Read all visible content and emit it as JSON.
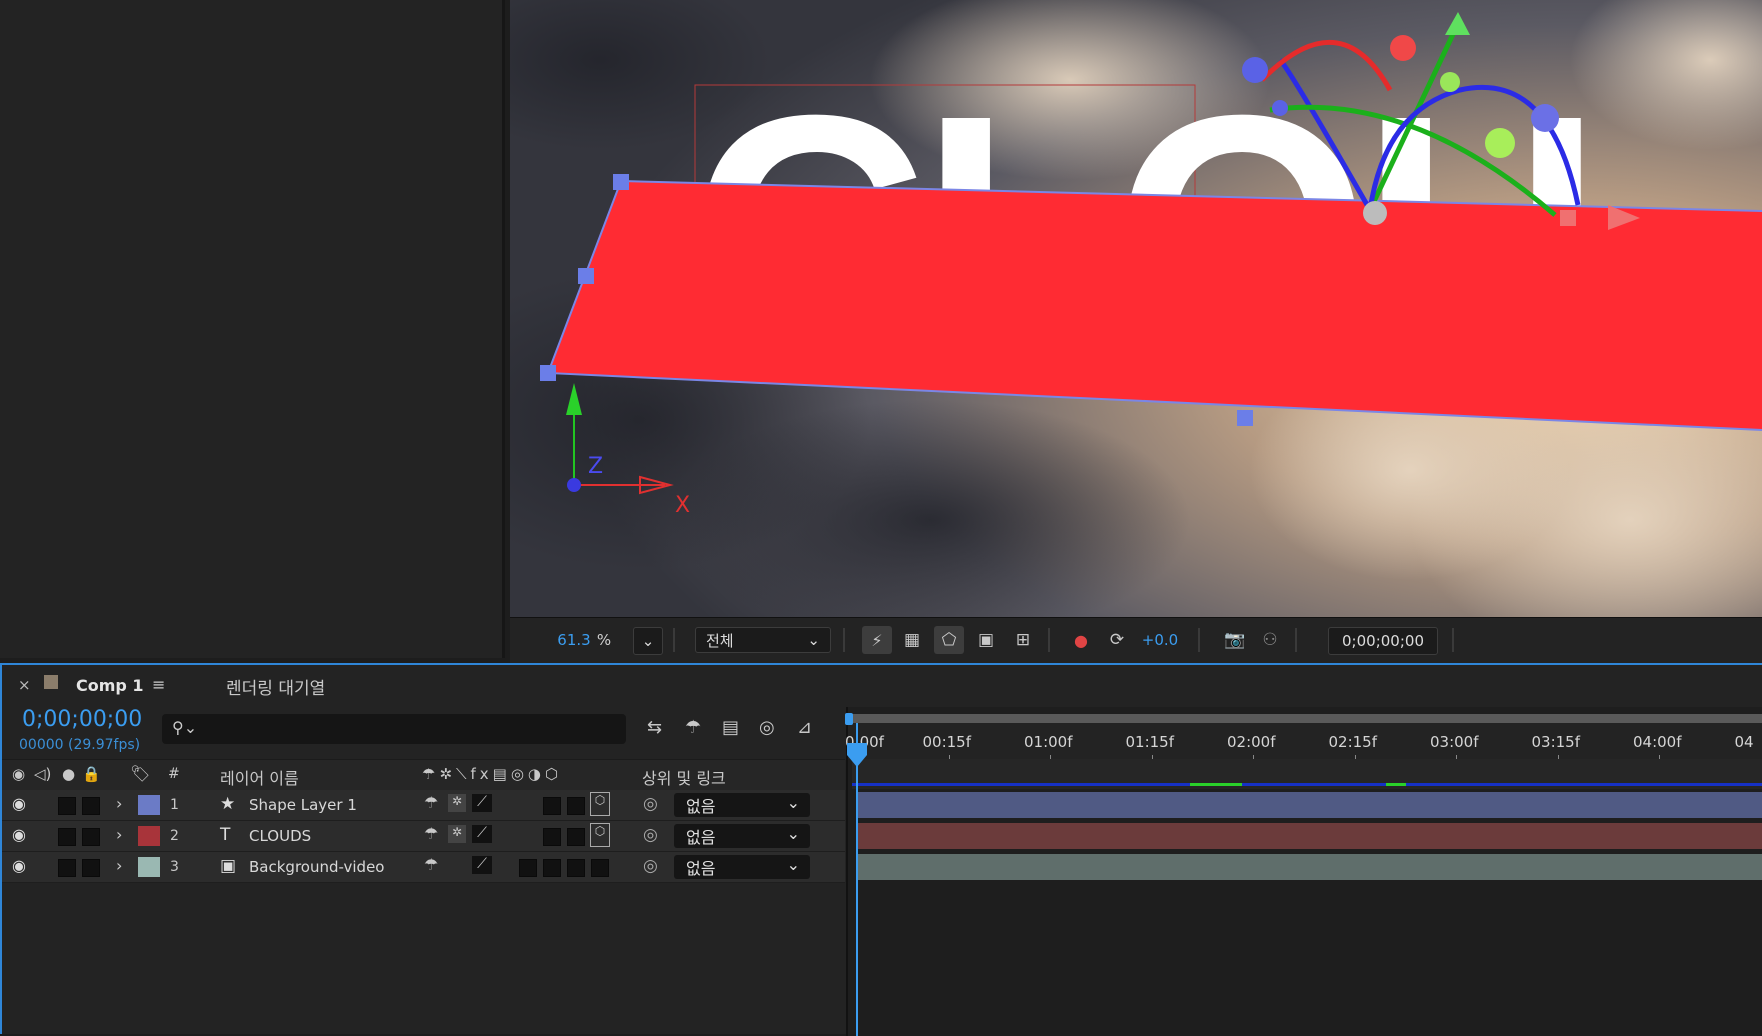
{
  "viewer": {
    "zoom_value": "61.3",
    "zoom_unit": "%",
    "resolution": "전체",
    "exposure": "+0.0",
    "timecode": "0;00;00;00",
    "canvas_text": "CLOU",
    "gizmo_z": "Z",
    "gizmo_x": "X"
  },
  "timeline": {
    "close": "×",
    "comp_tab": "Comp 1",
    "menu": "≡",
    "render_queue_tab": "렌더링 대기열",
    "current_time": "0;00;00;00",
    "frame_info": "00000 (29.97fps)",
    "search_placeholder": "",
    "col_hash": "#",
    "col_layer_name": "레이어 이름",
    "col_parent": "상위 및 링크",
    "layers": [
      {
        "num": "1",
        "name": "Shape Layer 1",
        "color": "#6b7bc6",
        "type": "★",
        "parent": "없음",
        "bar_color": "#505a84"
      },
      {
        "num": "2",
        "name": "CLOUDS",
        "color": "#a8343a",
        "type": "T",
        "parent": "없음",
        "bar_color": "#6b3b3b"
      },
      {
        "num": "3",
        "name": "Background-video",
        "color": "#9ab8b2",
        "type": "▣",
        "parent": "없음",
        "bar_color": "#5f6e6b"
      }
    ],
    "ruler": [
      "0:00f",
      "00:15f",
      "01:00f",
      "01:15f",
      "02:00f",
      "02:15f",
      "03:00f",
      "03:15f",
      "04:00f",
      "04"
    ]
  }
}
